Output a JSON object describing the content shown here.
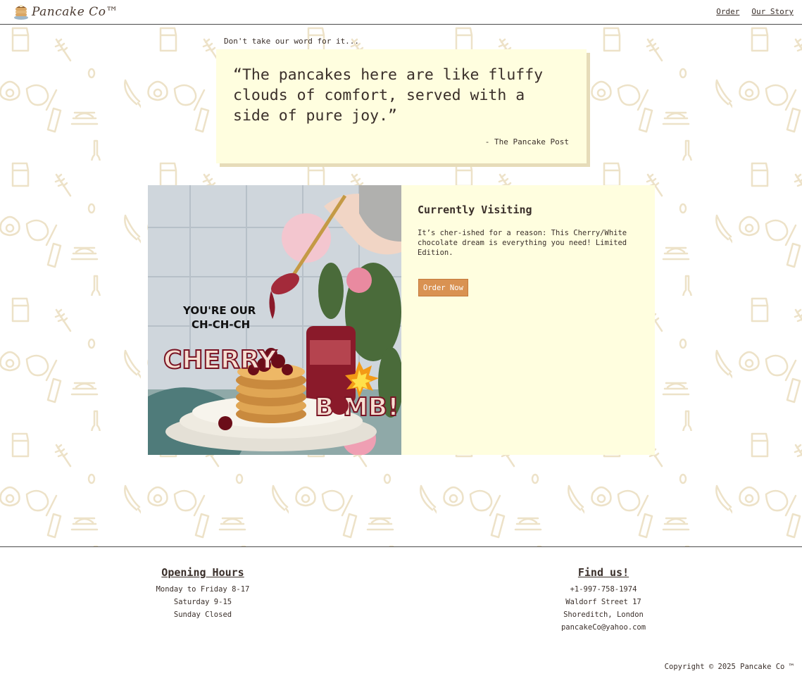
{
  "brand": {
    "name": "Pancake Co™"
  },
  "nav": {
    "items": [
      {
        "label": "Order"
      },
      {
        "label": "Our Story"
      }
    ]
  },
  "testimonial": {
    "tagline": "Don't take our word for it...",
    "quote": "“The pancakes here are like fluffy clouds of comfort, served with a side of pure joy.”",
    "source": "- The Pancake Post"
  },
  "feature": {
    "title": "Currently Visiting",
    "description": "It’s cher-ished for a reason: This Cherry/White chocolate dream is everything you need! Limited Edition.",
    "button_label": "Order Now",
    "image_text": {
      "line1": "YOU'RE  OUR",
      "line2": "CH-CH-CH",
      "word1": "CHERRY",
      "word2": "B MB!"
    }
  },
  "footer": {
    "hours": {
      "title": "Opening Hours",
      "lines": [
        "Monday to Friday 8-17",
        "Saturday 9-15",
        "Sunday Closed"
      ]
    },
    "find": {
      "title": "Find us!",
      "lines": [
        "+1-997-758-1974",
        "Waldorf Street 17",
        "Shoreditch, London",
        "pancakeCo@yahoo.com"
      ]
    },
    "copyright": "Copyright © 2025 Pancake Co ™"
  },
  "colors": {
    "accent": "#d99252",
    "card_bg": "#fffedf",
    "pattern": "#ede2c8",
    "text": "#3a2f2a"
  }
}
